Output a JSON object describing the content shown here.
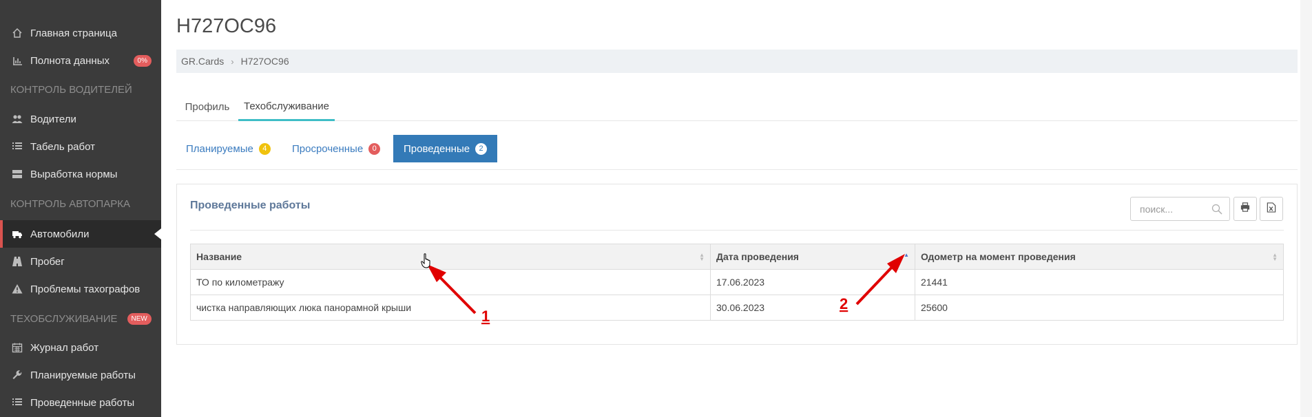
{
  "sidebar": {
    "items": [
      {
        "label": "Главная страница",
        "icon": "home-icon"
      },
      {
        "label": "Полнота данных",
        "icon": "bar-chart-icon",
        "badge": "0%"
      },
      {
        "label": "Водители",
        "icon": "users-icon"
      },
      {
        "label": "Табель работ",
        "icon": "list-icon"
      },
      {
        "label": "Выработка нормы",
        "icon": "server-icon"
      },
      {
        "label": "Автомобили",
        "icon": "truck-icon"
      },
      {
        "label": "Пробег",
        "icon": "road-icon"
      },
      {
        "label": "Проблемы тахографов",
        "icon": "warning-icon"
      },
      {
        "label": "Журнал работ",
        "icon": "calendar-icon"
      },
      {
        "label": "Планируемые работы",
        "icon": "wrench-icon"
      },
      {
        "label": "Проведенные работы",
        "icon": "list-icon"
      }
    ],
    "sections": {
      "drivers": "Контроль водителей",
      "fleet": "Контроль автопарка",
      "maintenance": "Техобслуживание",
      "maintenance_badge": "NEW"
    }
  },
  "page": {
    "title": "Н727ОС96",
    "breadcrumb": [
      "GR.Cards",
      "Н727ОС96"
    ]
  },
  "tabs": [
    "Профиль",
    "Техобслуживание"
  ],
  "subtabs": [
    {
      "label": "Планируемые",
      "count": "4",
      "color": "#f0c20d"
    },
    {
      "label": "Просроченные",
      "count": "0",
      "color": "#e35d5d"
    },
    {
      "label": "Проведенные",
      "count": "2",
      "color": "#ffffff"
    }
  ],
  "panel": {
    "title": "Проведенные работы",
    "search_placeholder": "поиск..."
  },
  "table": {
    "headers": [
      "Название",
      "Дата проведения",
      "Одометр на момент проведения"
    ],
    "rows": [
      [
        "ТО по километражу",
        "17.06.2023",
        "21441"
      ],
      [
        "чистка направляющих люка панорамной крыши",
        "30.06.2023",
        "25600"
      ]
    ]
  },
  "annotations": {
    "one": "1",
    "two": "2"
  },
  "colors": {
    "accent": "#337ab7",
    "annotation": "#e00000",
    "tab_underline": "#3ebdc6",
    "sidebar": "#3b3b3b"
  }
}
